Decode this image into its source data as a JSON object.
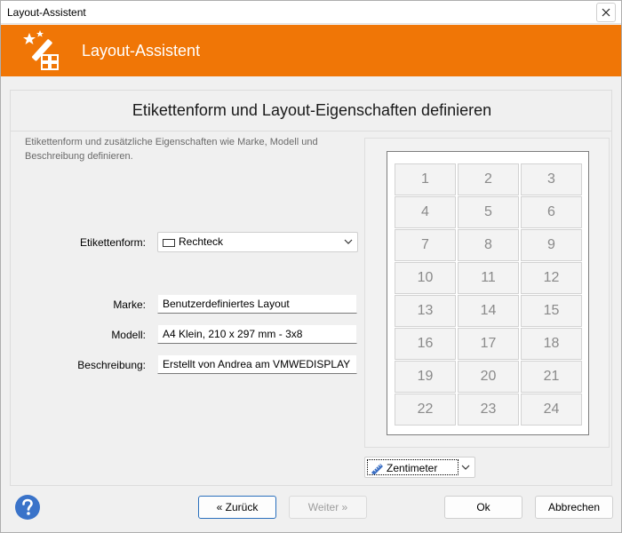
{
  "window": {
    "title": "Layout-Assistent"
  },
  "header": {
    "title": "Layout-Assistent",
    "icon": "wand-icon",
    "color": "#f07606"
  },
  "main": {
    "heading": "Etikettenform und Layout-Eigenschaften definieren",
    "description": "Etikettenform und zusätzliche Eigenschaften wie Marke, Modell und Beschreibung definieren."
  },
  "form": {
    "shape_label": "Etikettenform:",
    "shape_value": "Rechteck",
    "brand_label": "Marke:",
    "brand_value": "Benutzerdefiniertes Layout",
    "model_label": "Modell:",
    "model_value": "A4 Klein, 210 x 297 mm - 3x8",
    "description_label": "Beschreibung:",
    "description_value": "Erstellt von Andrea am VMWEDISPLAY"
  },
  "preview": {
    "columns": 3,
    "rows": 8,
    "labels": [
      "1",
      "2",
      "3",
      "4",
      "5",
      "6",
      "7",
      "8",
      "9",
      "10",
      "11",
      "12",
      "13",
      "14",
      "15",
      "16",
      "17",
      "18",
      "19",
      "20",
      "21",
      "22",
      "23",
      "24"
    ]
  },
  "unit": {
    "value": "Zentimeter"
  },
  "buttons": {
    "back": "« Zurück",
    "next": "Weiter »",
    "ok": "Ok",
    "cancel": "Abbrechen"
  }
}
